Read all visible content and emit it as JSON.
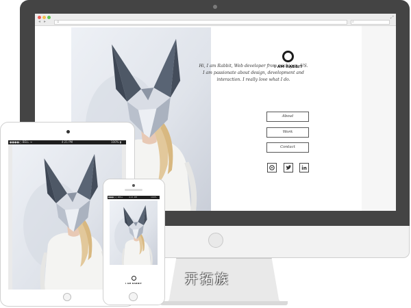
{
  "browser": {
    "back_icon": "chevron-left-icon",
    "forward_icon": "chevron-right-icon",
    "url_icon": "page-icon",
    "search_icon": "search-icon",
    "window_dots": [
      "#ec5f59",
      "#f5bf4f",
      "#61c554"
    ]
  },
  "site": {
    "brand": "I AM RABBIT",
    "intro": "Hi, I am Rabbit, Web developer from michigan, US. I am passionate about design, development and interaction. I really love what I do.",
    "menu": [
      {
        "label": "About"
      },
      {
        "label": "Work"
      },
      {
        "label": "Contact"
      }
    ],
    "social": [
      {
        "icon": "pinterest-icon",
        "glyph": "℗"
      },
      {
        "icon": "twitter-icon",
        "glyph": "🐦"
      },
      {
        "icon": "linkedin-icon",
        "glyph": "in"
      }
    ]
  },
  "ipad": {
    "carrier": "●●●●○ BELL ᯤ",
    "time": "4:21 PM",
    "battery": "100% ▮"
  },
  "iphone": {
    "carrier": "●●●○○ BELL",
    "time": "4:21 PM",
    "battery": "100%",
    "brand": "I AM RABBIT"
  },
  "watermark": "开拓族",
  "colors": {
    "bezel": "#444444",
    "device_frame": "#f2f2f2",
    "text": "#222222"
  }
}
